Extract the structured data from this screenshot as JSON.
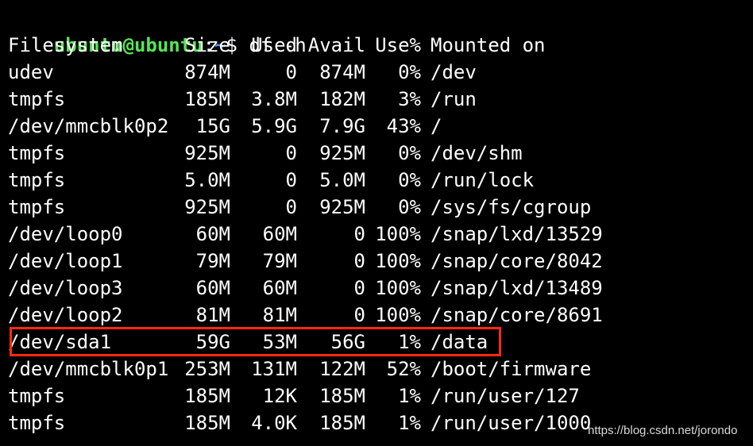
{
  "colors": {
    "background": "#000000",
    "text": "#ffffff",
    "prompt_user": "#54e655",
    "prompt_path": "#5a8cff",
    "highlight": "#ff2a10"
  },
  "prompt": {
    "user_host": "ubuntu@ubuntu",
    "separator": ":",
    "path": "~",
    "symbol": "$ ",
    "command": "df -h"
  },
  "table": {
    "headers": [
      "Filesystem",
      "Size",
      "Used",
      "Avail",
      "Use%",
      "Mounted on"
    ],
    "rows": [
      [
        "udev",
        "874M",
        "0",
        "874M",
        "0%",
        "/dev"
      ],
      [
        "tmpfs",
        "185M",
        "3.8M",
        "182M",
        "3%",
        "/run"
      ],
      [
        "/dev/mmcblk0p2",
        "15G",
        "5.9G",
        "7.9G",
        "43%",
        "/"
      ],
      [
        "tmpfs",
        "925M",
        "0",
        "925M",
        "0%",
        "/dev/shm"
      ],
      [
        "tmpfs",
        "5.0M",
        "0",
        "5.0M",
        "0%",
        "/run/lock"
      ],
      [
        "tmpfs",
        "925M",
        "0",
        "925M",
        "0%",
        "/sys/fs/cgroup"
      ],
      [
        "/dev/loop0",
        "60M",
        "60M",
        "0",
        "100%",
        "/snap/lxd/13529"
      ],
      [
        "/dev/loop1",
        "79M",
        "79M",
        "0",
        "100%",
        "/snap/core/8042"
      ],
      [
        "/dev/loop3",
        "60M",
        "60M",
        "0",
        "100%",
        "/snap/lxd/13489"
      ],
      [
        "/dev/loop2",
        "81M",
        "81M",
        "0",
        "100%",
        "/snap/core/8691"
      ],
      [
        "/dev/sda1",
        "59G",
        "53M",
        "56G",
        "1%",
        "/data"
      ],
      [
        "/dev/mmcblk0p1",
        "253M",
        "131M",
        "122M",
        "52%",
        "/boot/firmware"
      ],
      [
        "tmpfs",
        "185M",
        "12K",
        "185M",
        "1%",
        "/run/user/127"
      ],
      [
        "tmpfs",
        "185M",
        "4.0K",
        "185M",
        "1%",
        "/run/user/1000"
      ]
    ],
    "highlighted_row": "/dev/sda1"
  },
  "watermark": "https://blog.csdn.net/jorondo"
}
